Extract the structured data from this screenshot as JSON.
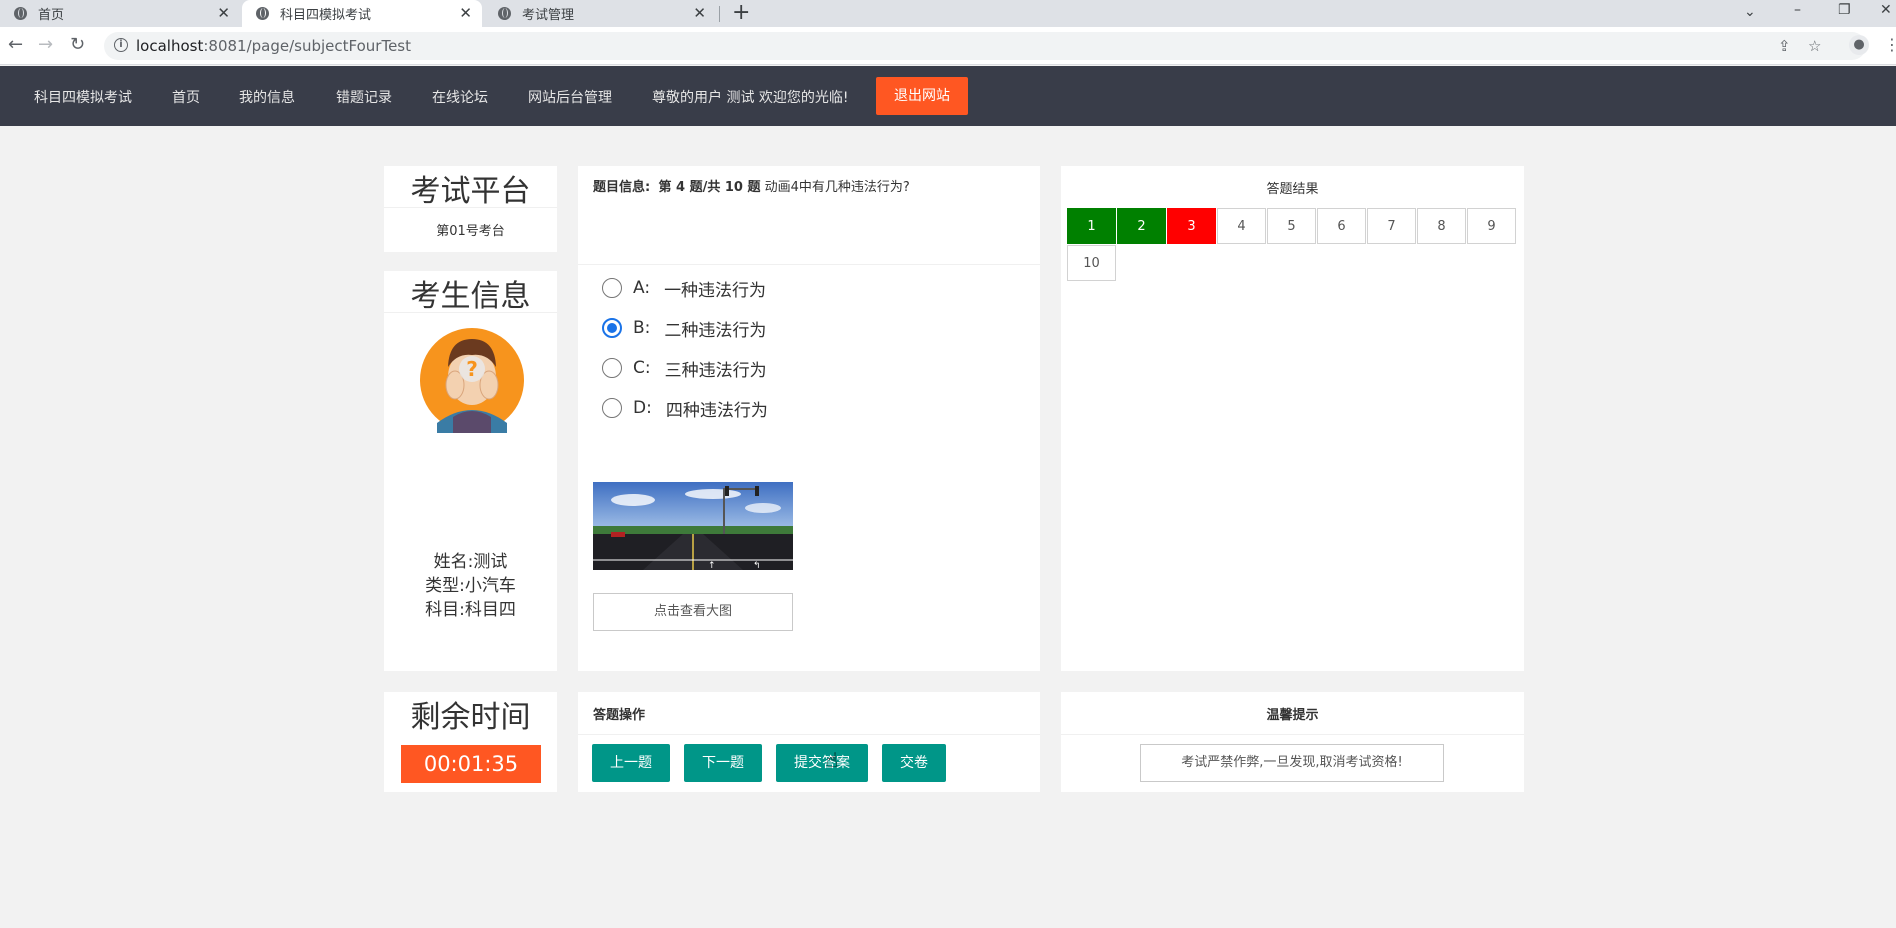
{
  "browser": {
    "tabs": [
      {
        "title": "首页",
        "active": false
      },
      {
        "title": "科目四模拟考试",
        "active": true
      },
      {
        "title": "考试管理",
        "active": false
      }
    ],
    "url_host": "localhost",
    "url_rest": ":8081/page/subjectFourTest"
  },
  "nav": {
    "brand": "科目四模拟考试",
    "home": "首页",
    "my_info": "我的信息",
    "mistakes": "错题记录",
    "forum": "在线论坛",
    "admin": "网站后台管理",
    "welcome": "尊敬的用户 测试 欢迎您的光临!",
    "logout": "退出网站"
  },
  "platform": {
    "title": "考试平台",
    "room": "第01号考台"
  },
  "question": {
    "label": "题目信息:",
    "progress": "第 4 题/共 10 题",
    "text": "动画4中有几种违法行为?",
    "options": [
      {
        "letter": "A:",
        "text": "一种违法行为",
        "checked": false
      },
      {
        "letter": "B:",
        "text": "二种违法行为",
        "checked": true
      },
      {
        "letter": "C:",
        "text": "三种违法行为",
        "checked": false
      },
      {
        "letter": "D:",
        "text": "四种违法行为",
        "checked": false
      }
    ],
    "view_big_image": "点击查看大图"
  },
  "results": {
    "title": "答题结果",
    "items": [
      {
        "num": "1",
        "state": "correct"
      },
      {
        "num": "2",
        "state": "correct"
      },
      {
        "num": "3",
        "state": "wrong"
      },
      {
        "num": "4",
        "state": "none"
      },
      {
        "num": "5",
        "state": "none"
      },
      {
        "num": "6",
        "state": "none"
      },
      {
        "num": "7",
        "state": "none"
      },
      {
        "num": "8",
        "state": "none"
      },
      {
        "num": "9",
        "state": "none"
      },
      {
        "num": "10",
        "state": "none"
      }
    ]
  },
  "examinee": {
    "title": "考生信息",
    "name": "姓名:测试",
    "type": "类型:小汽车",
    "subject": "科目:科目四"
  },
  "timer": {
    "title": "剩余时间",
    "value": "00:01:35"
  },
  "operations": {
    "title": "答题操作",
    "prev": "上一题",
    "next": "下一题",
    "submit": "提交答案",
    "hand_in": "交卷"
  },
  "tips": {
    "title": "温馨提示",
    "text": "考试严禁作弊,一旦发现,取消考试资格!"
  },
  "colors": {
    "nav_bg": "#393d49",
    "accent_orange": "#ff5722",
    "teal_button": "#009688",
    "correct": "#008000",
    "wrong": "#ff0000"
  }
}
